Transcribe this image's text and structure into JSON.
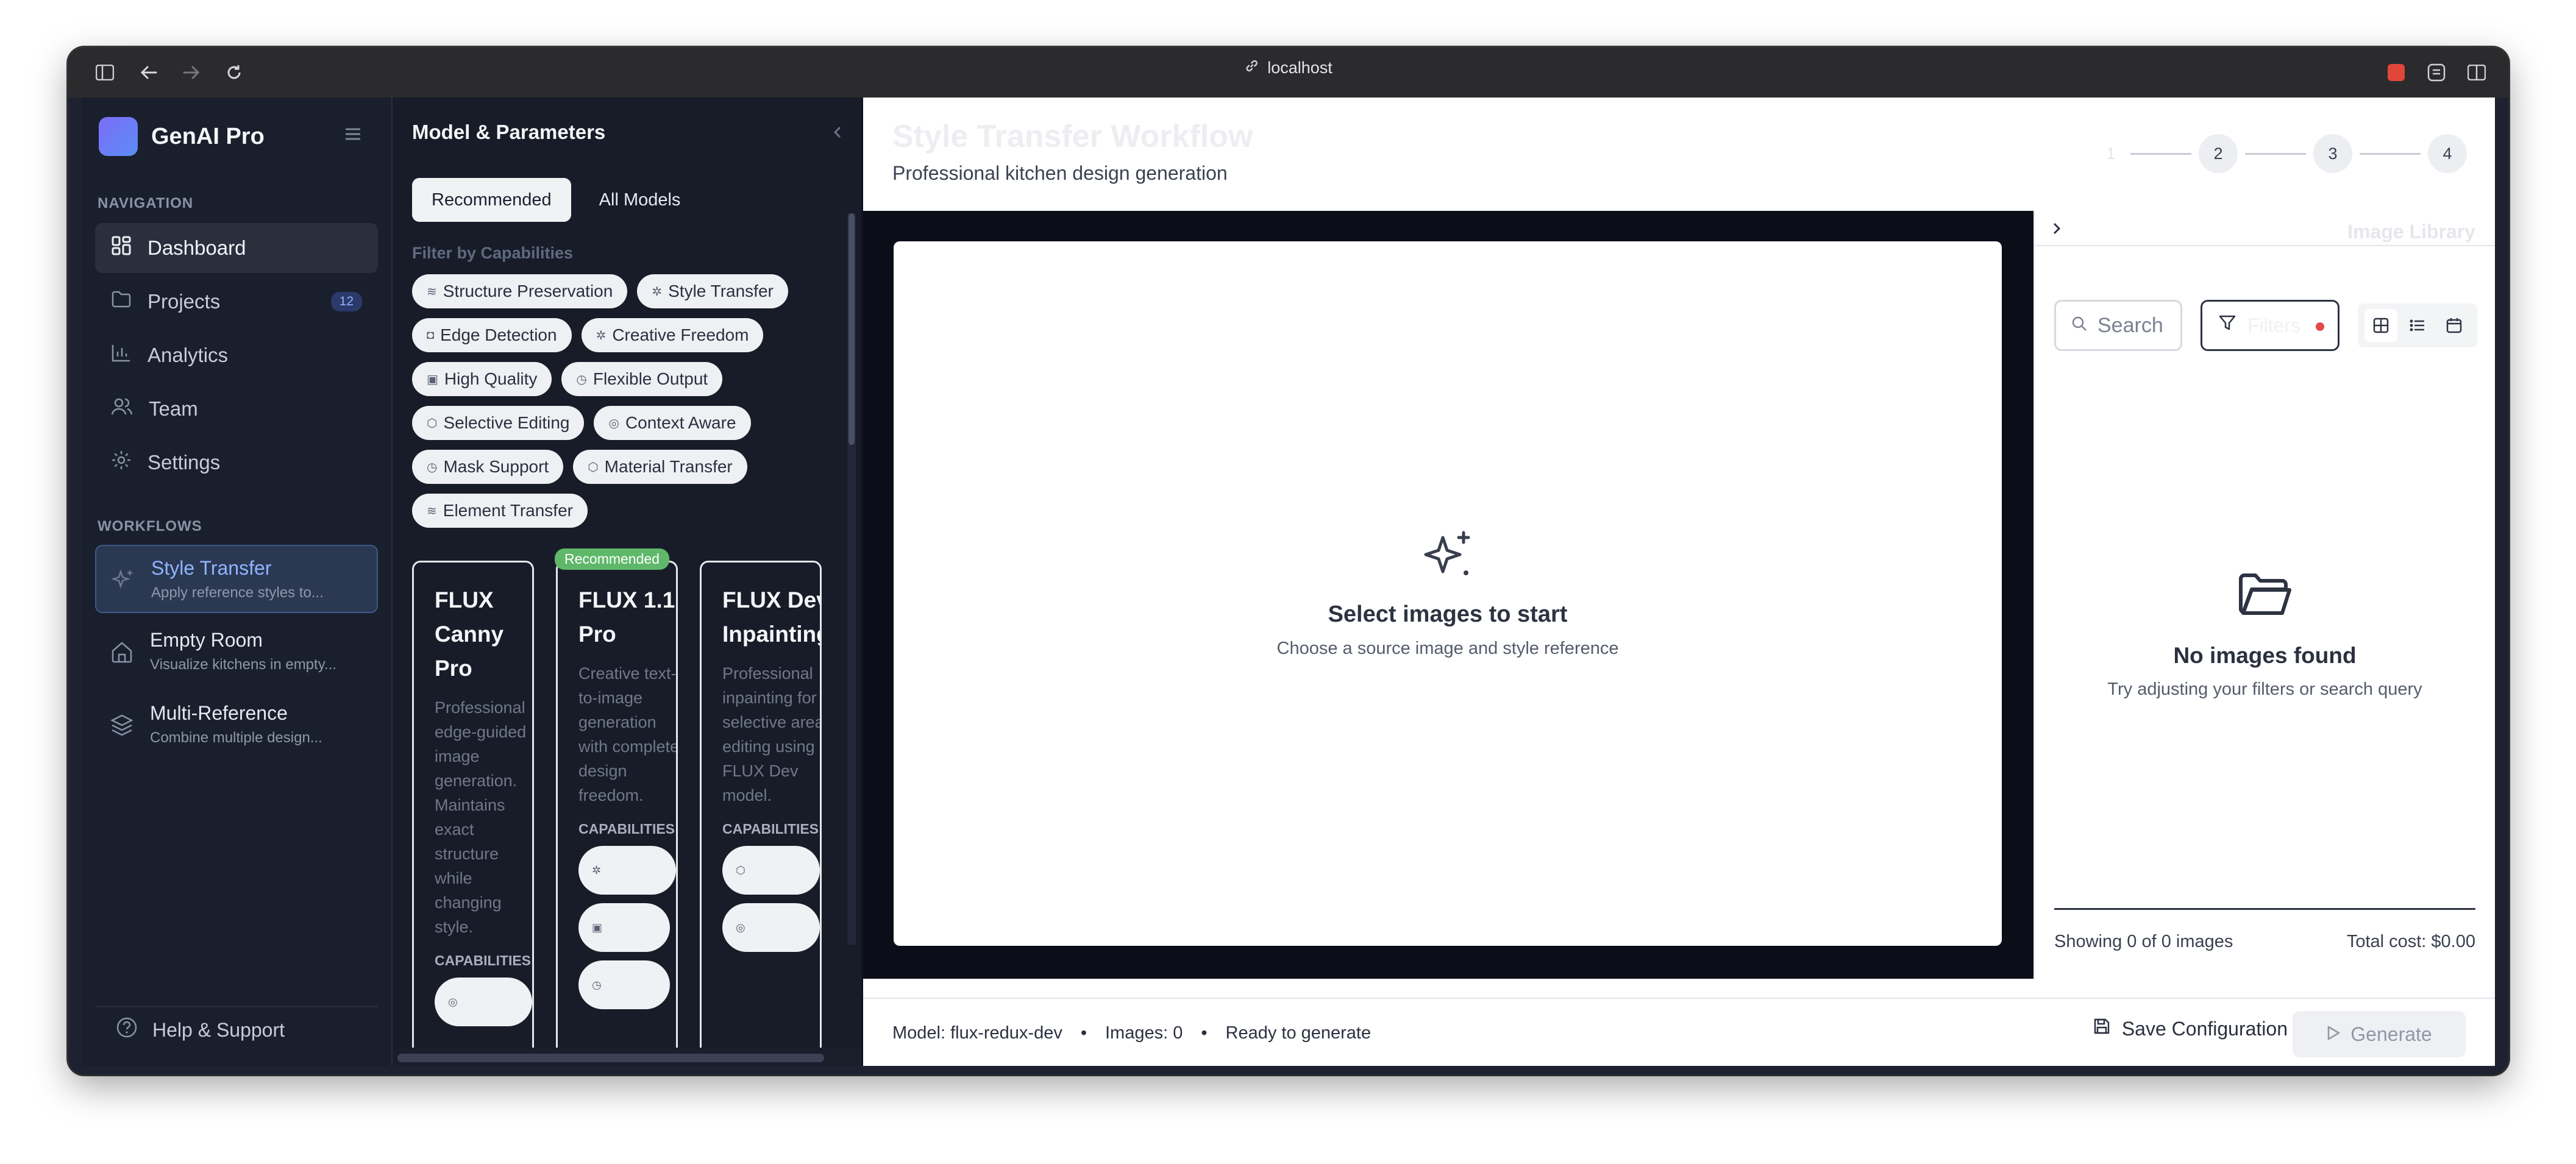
{
  "browser": {
    "url": "localhost"
  },
  "brand": {
    "name": "GenAI Pro"
  },
  "nav": {
    "section_label": "NAVIGATION",
    "items": [
      {
        "label": "Dashboard",
        "icon": "dashboard-icon"
      },
      {
        "label": "Projects",
        "icon": "folder-icon",
        "badge": "12"
      },
      {
        "label": "Analytics",
        "icon": "chart-icon"
      },
      {
        "label": "Team",
        "icon": "team-icon"
      },
      {
        "label": "Settings",
        "icon": "gear-icon"
      }
    ],
    "workflows_label": "WORKFLOWS",
    "workflows": [
      {
        "title": "Style Transfer",
        "subtitle": "Apply reference styles to..."
      },
      {
        "title": "Empty Room",
        "subtitle": "Visualize kitchens in empty..."
      },
      {
        "title": "Multi-Reference",
        "subtitle": "Combine multiple design..."
      }
    ],
    "help": "Help & Support"
  },
  "models": {
    "header": "Model & Parameters",
    "tabs": [
      "Recommended",
      "All Models"
    ],
    "filter_label": "Filter by Capabilities",
    "chips": [
      "Structure Preservation",
      "Style Transfer",
      "Edge Detection",
      "Creative Freedom",
      "High Quality",
      "Flexible Output",
      "Selective Editing",
      "Context Aware",
      "Mask Support",
      "Material Transfer",
      "Element Transfer"
    ],
    "recommended_badge": "Recommended",
    "cards": [
      {
        "title": "FLUX Canny Pro",
        "desc": "Professional edge-guided image generation. Maintains exact structure while changing style.",
        "cap_label": "CAPABILITIES"
      },
      {
        "title": "FLUX 1.1 Pro",
        "desc": "Creative text-to-image generation with complete design freedom.",
        "cap_label": "CAPABILITIES"
      },
      {
        "title": "FLUX Dev Inpainting",
        "desc": "Professional inpainting for selective area editing using FLUX Dev model.",
        "cap_label": "CAPABILITIES"
      }
    ]
  },
  "main": {
    "title": "Style Transfer Workflow",
    "subtitle": "Professional kitchen design generation",
    "steps": [
      "1",
      "2",
      "3",
      "4"
    ],
    "canvas": {
      "title": "Select images to start",
      "hint": "Choose a source image and style reference"
    }
  },
  "library": {
    "title": "Image Library",
    "search_placeholder": "Search",
    "filters_label": "Filters",
    "empty_title": "No images found",
    "empty_hint": "Try adjusting your filters or search query",
    "showing": "Showing 0 of 0 images",
    "total_cost": "Total cost: $0.00"
  },
  "footer": {
    "model": "Model: flux-redux-dev",
    "images": "Images: 0",
    "status": "Ready to generate",
    "save": "Save Configuration",
    "generate": "Generate"
  },
  "colors": {
    "accent": "#8fb4ff",
    "recommended": "#5fb86a",
    "filter_dot": "#e24b4b"
  }
}
